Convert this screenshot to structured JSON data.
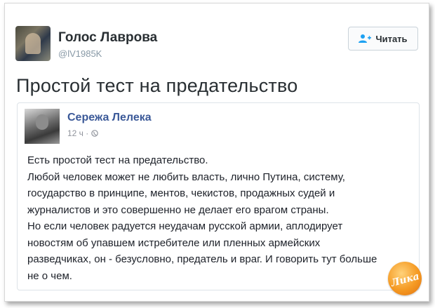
{
  "tweet": {
    "author_name": "Голос Лаврова",
    "author_handle": "@lV1985K",
    "follow_label": "Читать",
    "text": "Простой тест на предательство"
  },
  "embedded_post": {
    "author_name": "Сережа Лелека",
    "time": "12 ч ·",
    "lines": [
      "Есть простой тест на предательство.",
      "Любой человек может не любить власть, лично Путина, систему,",
      "государство в принципе, ментов, чекистов, продажных судей и",
      "журналистов и это совершенно не делает его врагом страны.",
      "Но если человек радуется неудачам русской армии, аплодирует",
      "новостям об упавшем истребителе или пленных армейских",
      "разведчиках, он - безусловно, предатель и враг. И говорить тут больше",
      "не о чем."
    ]
  },
  "watermark": {
    "text": "Лика"
  },
  "colors": {
    "accent": "#3b5998",
    "text": "#292f33",
    "muted": "#8899a6",
    "follow_icon": "#1da1f2"
  }
}
